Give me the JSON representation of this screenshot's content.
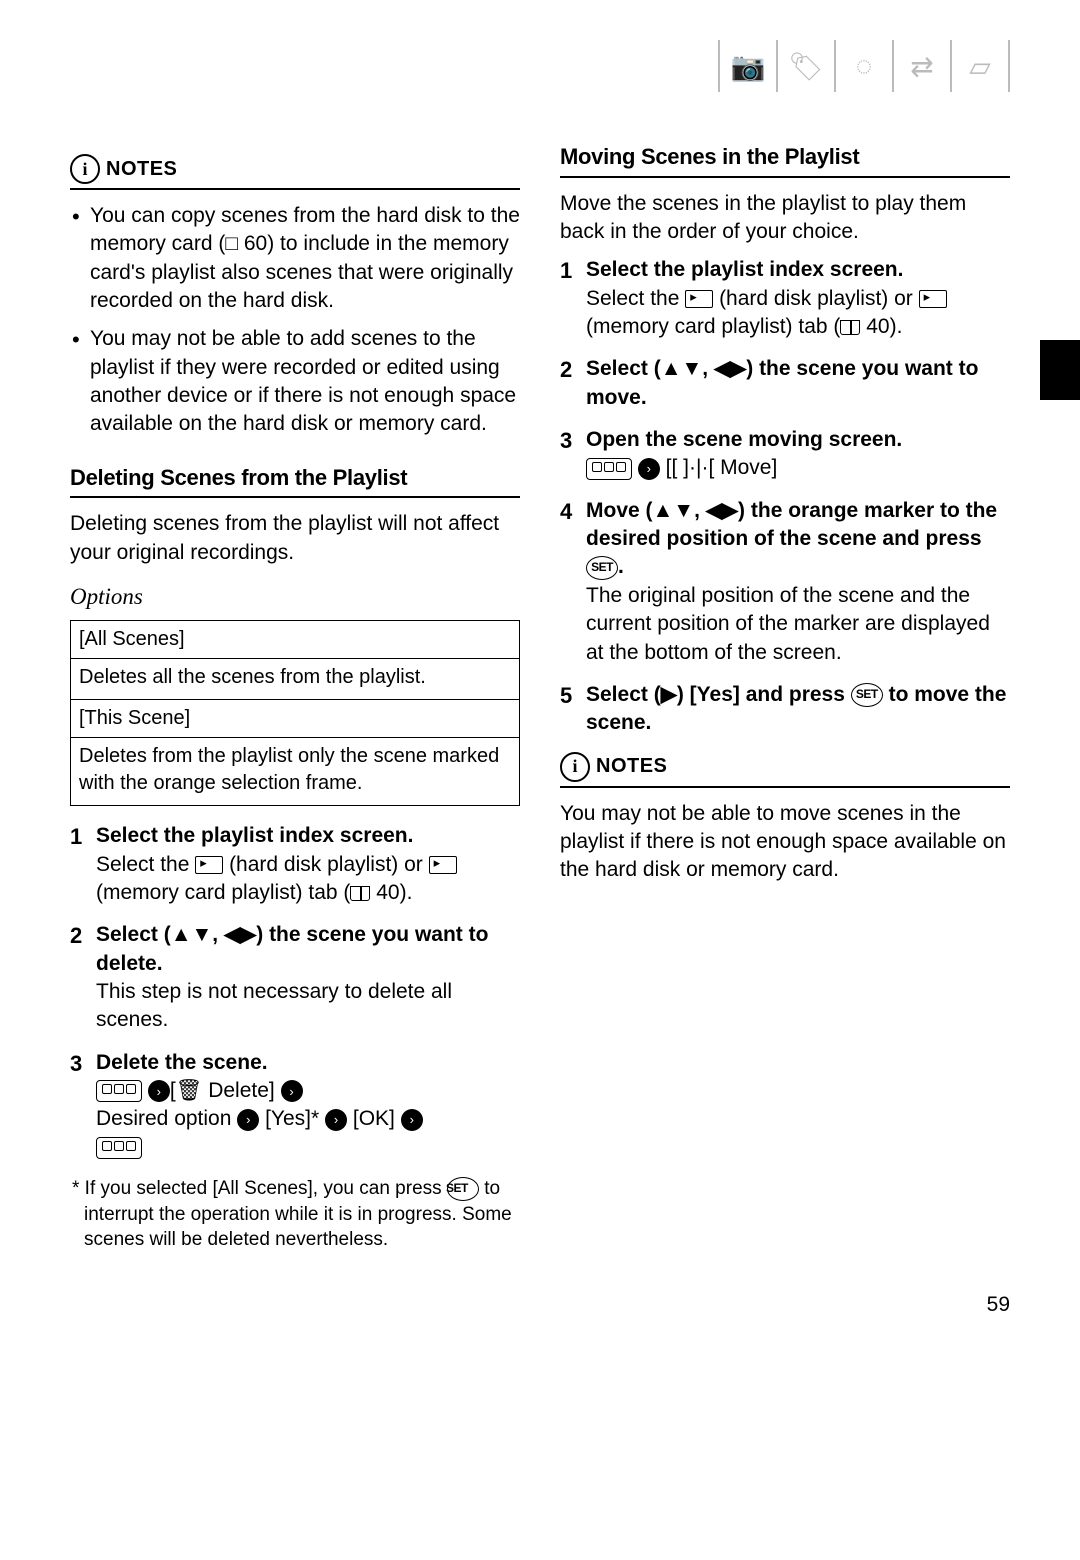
{
  "header_icons": [
    "camera-icon",
    "tag-icon",
    "disc-icon",
    "transfer-icon",
    "book-icon"
  ],
  "left": {
    "notes_label": "NOTES",
    "notes": [
      "You can copy scenes from the hard disk to the memory card (□ 60) to include in the memory card's playlist also scenes that were originally recorded on the hard disk.",
      "You may not be able to add scenes to the playlist if they were recorded or edited using another device or if there is not enough space available on the hard disk or memory card."
    ],
    "section_title": "Deleting Scenes from the Playlist",
    "intro": "Deleting scenes from the playlist will not affect your original recordings.",
    "options_label": "Options",
    "options": [
      {
        "head": "[All Scenes]",
        "body": "Deletes all the scenes from the playlist."
      },
      {
        "head": "[This Scene]",
        "body": "Deletes from the playlist only the scene marked with the orange selection frame."
      }
    ],
    "steps": [
      {
        "head": "Select the playlist index screen.",
        "body_pre": "Select the ",
        "body_mid1": " (hard disk playlist) or ",
        "body_mid2": " (memory card playlist) tab (",
        "body_ref": " 40)."
      },
      {
        "head": "Select (▲▼, ◀▶) the scene you want to delete.",
        "body": "This step is not necessary to delete all scenes."
      },
      {
        "head": "Delete the scene.",
        "seq_delete": " Delete] ",
        "seq_desired": "Desired option ",
        "seq_yes": " [Yes]* ",
        "seq_ok": " [OK] "
      }
    ],
    "footnote_pre": "* If you selected [All Scenes], you can press ",
    "footnote_post": " to interrupt the operation while it is in progress. Some scenes will be deleted nevertheless."
  },
  "right": {
    "section_title": "Moving Scenes in the Playlist",
    "intro": "Move the scenes in the playlist to play them back in the order of your choice.",
    "steps": [
      {
        "head": "Select the playlist index screen.",
        "body_pre": "Select the ",
        "body_mid1": " (hard disk playlist) or ",
        "body_mid2": " (memory card playlist) tab (",
        "body_ref": " 40)."
      },
      {
        "head": "Select (▲▼, ◀▶) the scene you want to move."
      },
      {
        "head": "Open the scene moving screen.",
        "seq_move": "  Move]"
      },
      {
        "head_pre": "Move (▲▼, ◀▶) the orange marker to the desired position of the scene and press ",
        "head_post": ".",
        "body": "The original position of the scene and the current position of the marker are displayed at the bottom of the screen."
      },
      {
        "head_pre": "Select (▶) [Yes] and press ",
        "head_post": " to move the scene."
      }
    ],
    "notes_label": "NOTES",
    "notes_text": "You may not be able to move scenes in the playlist if there is not enough space available on the hard disk or memory card."
  },
  "page_number": "59",
  "glyphs": {
    "trash": "🗑",
    "move": "[ ]·|·[",
    "right_in_circle": "›"
  }
}
